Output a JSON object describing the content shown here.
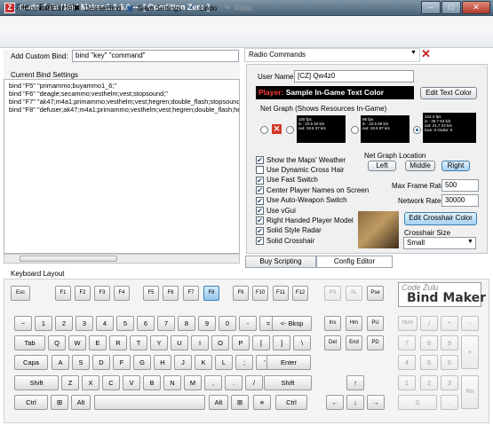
{
  "app": {
    "title": "Code Zulu Bind Maker 1.1.6.0 --- [ Condition Zero ]"
  },
  "menu": [
    "File",
    "Edit",
    "Help"
  ],
  "toolbar": {
    "commit": "Commit Edit",
    "delete": "Delete Bind",
    "save": "Save Settings",
    "undo": "Undo",
    "redo": "Redo"
  },
  "custom": {
    "label": "Add Custom Bind:",
    "value": "bind \"key\" \"command\""
  },
  "current": {
    "label": "Current Bind Settings",
    "lines": [
      "bind \"F5\" \"primammo;buyammo1_6;\"",
      "bind \"F6\" \"deagle;secammo;vesthelm;vest;stopsound;\"",
      "bind \"F7\" \"ak47;m4a1;primammo;vesthelm;vest;hegren;double_flash;stopsound;\"",
      "bind \"F8\" \"defuser;ak47;m4a1;primammo;vesthelm;vest;hegren;double_flash;hegren;stopsound;\""
    ]
  },
  "radio": {
    "value": "Radio Commands"
  },
  "config": {
    "username_label": "User Name",
    "username": "[CZ] Qw4z0",
    "player_label": "Player:",
    "player_text": "Sample In-Game Text Color",
    "edit_text_color": "Edit Text Color",
    "netgraph_label": "Net Graph (Shows Resources In-Game)",
    "netgraph_thumbs": [
      [
        "100 fps",
        "in : 22.5 52 k/s",
        "out: 19.5 37 k/s"
      ],
      [
        "96 fps",
        "in : 22.5 69 k/s",
        "out: 19.5 97 k/s"
      ],
      [
        "124.3 fps",
        "in : 39.7 64 k/s",
        "out: 21.7 24 k/s",
        "loss: 0  choke: 0"
      ]
    ],
    "checkboxes": [
      {
        "label": "Show the Maps' Weather",
        "checked": true
      },
      {
        "label": "Use Dynamic Cross Hair",
        "checked": false
      },
      {
        "label": "Use Fast Switch",
        "checked": true
      },
      {
        "label": "Center Player Names on Screen",
        "checked": true
      },
      {
        "label": "Use Auto-Weapon Switch",
        "checked": true
      },
      {
        "label": "Use vGui",
        "checked": true
      },
      {
        "label": "Right Handed Player Model",
        "checked": true
      },
      {
        "label": "Solid Style Radar",
        "checked": true
      },
      {
        "label": "Solid Crosshair",
        "checked": true
      }
    ],
    "location_label": "Net Graph Location",
    "locations": [
      "Left",
      "Middle",
      "Right"
    ],
    "selected_location": "Right",
    "max_frame_label": "Max Frame Rate",
    "max_frame": "500",
    "network_label": "Network Rate",
    "network": "30000",
    "edit_crosshair": "Edit Crosshair Color",
    "crosshair_size_label": "Crosshair Size",
    "crosshair_size": "Small"
  },
  "tabs": [
    "Buy Scripting",
    "Config Editor"
  ],
  "keyboard": {
    "label": "Keyboard Layout",
    "logo_top": "Code Zulu",
    "logo_bottom": "Bind Maker"
  },
  "colors": {
    "player_label": "#ff3b3b",
    "player_text": "#ffffff",
    "accent": "#3c7fb1"
  }
}
